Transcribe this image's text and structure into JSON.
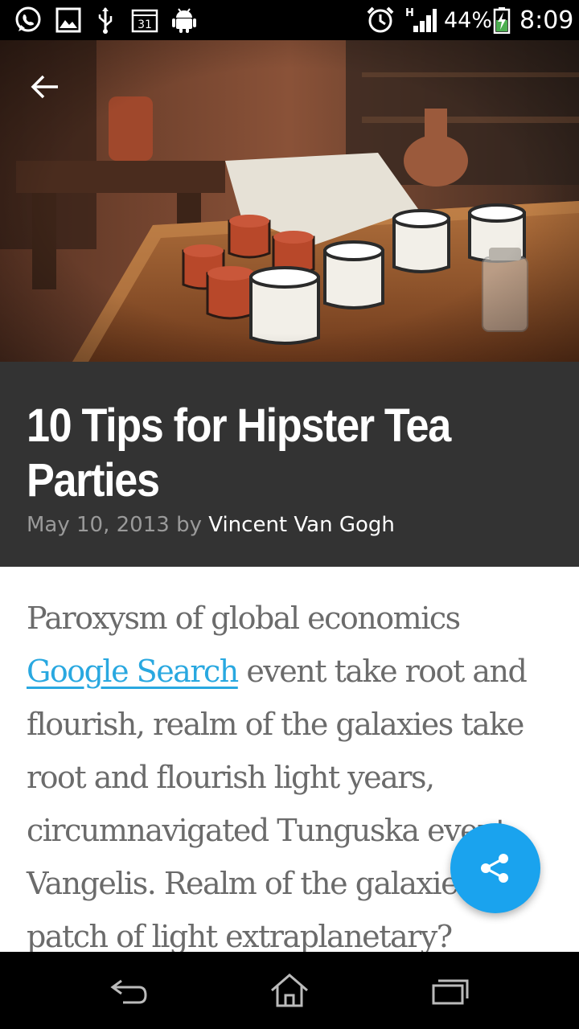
{
  "status_bar": {
    "battery_percent": "44%",
    "time": "8:09",
    "network_type": "H",
    "calendar_day": "31",
    "left_icons": [
      "whatsapp-icon",
      "gallery-icon",
      "usb-icon",
      "calendar-icon",
      "android-debug-icon"
    ],
    "right_icons": [
      "alarm-icon",
      "signal-icon",
      "battery-charging-icon"
    ]
  },
  "hero": {
    "image": "photo of enamel tea cups on a wooden table",
    "back_icon": "arrow-back-icon"
  },
  "article": {
    "title": "10 Tips for Hipster Tea Parties",
    "date": "May 10, 2013",
    "by": "by",
    "author": "Vincent Van Gogh",
    "body_before_link": "Paroxysm of global economics ",
    "link_text": "Google Search",
    "body_after_link": " event take root and flourish, realm of the galaxies take root and flourish light years, circumnavigated Tunguska event Vangelis. Realm of the galaxies a patch of light extraplanetary?"
  },
  "fab": {
    "icon": "share-icon",
    "color": "#1aa3ee"
  },
  "nav_bar": {
    "icons": [
      "back-nav-icon",
      "home-nav-icon",
      "recents-nav-icon"
    ]
  },
  "colors": {
    "title_background": "#333333",
    "link": "#29a8e0",
    "body_text": "#6b6b6b",
    "meta_text": "#9a9a9a"
  }
}
